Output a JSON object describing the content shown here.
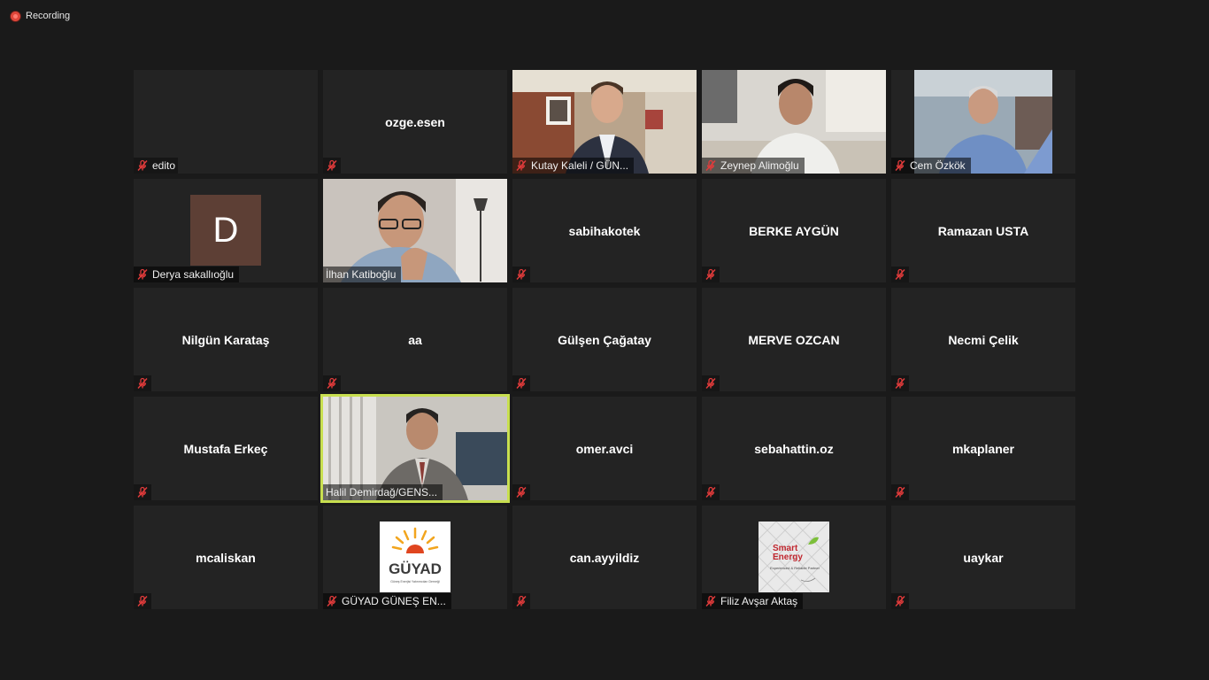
{
  "recording": {
    "label": "Recording"
  },
  "participants": [
    {
      "name": "edito",
      "type": "blank"
    },
    {
      "name": "ozge.esen",
      "type": "text"
    },
    {
      "name": "Kutay Kaleli / GÜN...",
      "type": "video"
    },
    {
      "name": "Zeynep Alimoğlu",
      "type": "video"
    },
    {
      "name": "Cem Özkök",
      "type": "video"
    },
    {
      "name": "Derya sakallıoğlu",
      "type": "avatar",
      "initial": "D"
    },
    {
      "name": "İlhan Katiboğlu",
      "type": "video"
    },
    {
      "name": "sabihakotek",
      "type": "text"
    },
    {
      "name": "BERKE AYGÜN",
      "type": "text"
    },
    {
      "name": "Ramazan USTA",
      "type": "text"
    },
    {
      "name": "Nilgün Karataş",
      "type": "text"
    },
    {
      "name": "aa",
      "type": "text"
    },
    {
      "name": "Gülşen Çağatay",
      "type": "text"
    },
    {
      "name": "MERVE OZCAN",
      "type": "text"
    },
    {
      "name": "Necmi Çelik",
      "type": "text"
    },
    {
      "name": "Mustafa Erkeç",
      "type": "text"
    },
    {
      "name": "Halil Demirdağ/GENS...",
      "type": "video",
      "active_speaker": true
    },
    {
      "name": "omer.avci",
      "type": "text"
    },
    {
      "name": "sebahattin.oz",
      "type": "text"
    },
    {
      "name": "mkaplaner",
      "type": "text"
    },
    {
      "name": "mcaliskan",
      "type": "text"
    },
    {
      "name": "GÜYAD GÜNEŞ EN...",
      "type": "logo",
      "logo_text": "GÜYAD",
      "logo_subtext": "Güneş Enerjisi Yatırımcıları Derneği"
    },
    {
      "name": "can.ayyildiz",
      "type": "text"
    },
    {
      "name": "Filiz Avşar Aktaş",
      "type": "logo",
      "logo_text": "Smart Energy",
      "logo_subtext": "Experienced & Reliable Partner"
    },
    {
      "name": "uaykar",
      "type": "text"
    }
  ],
  "colors": {
    "background": "#1a1a1a",
    "tile": "#232323",
    "active_speaker_border": "#c8df4f",
    "muted_icon": "#e23b3b",
    "recording_dot": "#e0463a",
    "avatar_d": "#5d3f35"
  },
  "icons": {
    "muted": "mic-muted-icon",
    "recording": "recording-dot-icon"
  }
}
